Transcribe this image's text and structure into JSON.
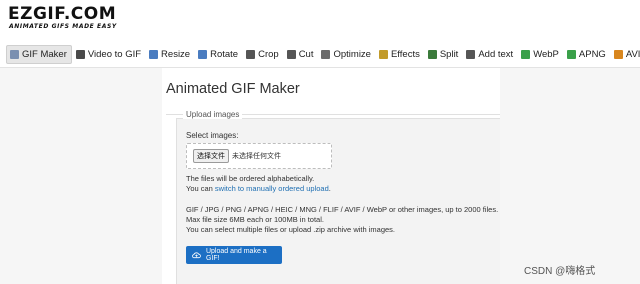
{
  "header": {
    "logo_text": "EZGIF.COM",
    "logo_tagline": "ANIMATED GIFS MADE EASY"
  },
  "nav": {
    "items": [
      {
        "label": "GIF Maker",
        "icon": "gif-maker-icon",
        "color": "#7a8fb0"
      },
      {
        "label": "Video to GIF",
        "icon": "film-icon",
        "color": "#4a4a4a"
      },
      {
        "label": "Resize",
        "icon": "resize-icon",
        "color": "#4a7cc0"
      },
      {
        "label": "Rotate",
        "icon": "rotate-icon",
        "color": "#4a7cc0"
      },
      {
        "label": "Crop",
        "icon": "crop-icon",
        "color": "#555555"
      },
      {
        "label": "Cut",
        "icon": "cut-icon",
        "color": "#555555"
      },
      {
        "label": "Optimize",
        "icon": "optimize-icon",
        "color": "#6b6b6b"
      },
      {
        "label": "Effects",
        "icon": "effects-icon",
        "color": "#c29b2a"
      },
      {
        "label": "Split",
        "icon": "split-icon",
        "color": "#3b7a3b"
      },
      {
        "label": "Add text",
        "icon": "add-text-icon",
        "color": "#555555"
      },
      {
        "label": "WebP",
        "icon": "webp-icon",
        "color": "#3aa04a"
      },
      {
        "label": "APNG",
        "icon": "apng-icon",
        "color": "#3aa04a"
      },
      {
        "label": "AVIF",
        "icon": "avif-icon",
        "color": "#d8861e"
      }
    ]
  },
  "main": {
    "title": "Animated GIF Maker",
    "fieldset_legend": "Upload images",
    "select_label": "Select images:",
    "file_button": "选择文件",
    "file_status": "未选择任何文件",
    "order_note": "The files will be ordered alphabetically.",
    "manual_prefix": "You can ",
    "manual_link": "switch to manually ordered upload",
    "manual_suffix": ".",
    "formats_note": "GIF / JPG / PNG / APNG / HEIC / MNG / FLIF / AVIF / WebP or other images, up to 2000 files.",
    "size_note": "Max file size 6MB each or 100MB in total.",
    "zip_note": "You can select multiple files or upload .zip archive with images.",
    "upload_button": "Upload and make a GIF!"
  },
  "watermark": "CSDN @嗨格式",
  "colors": {
    "accent": "#1c6fc4",
    "link": "#1f6fb2"
  }
}
